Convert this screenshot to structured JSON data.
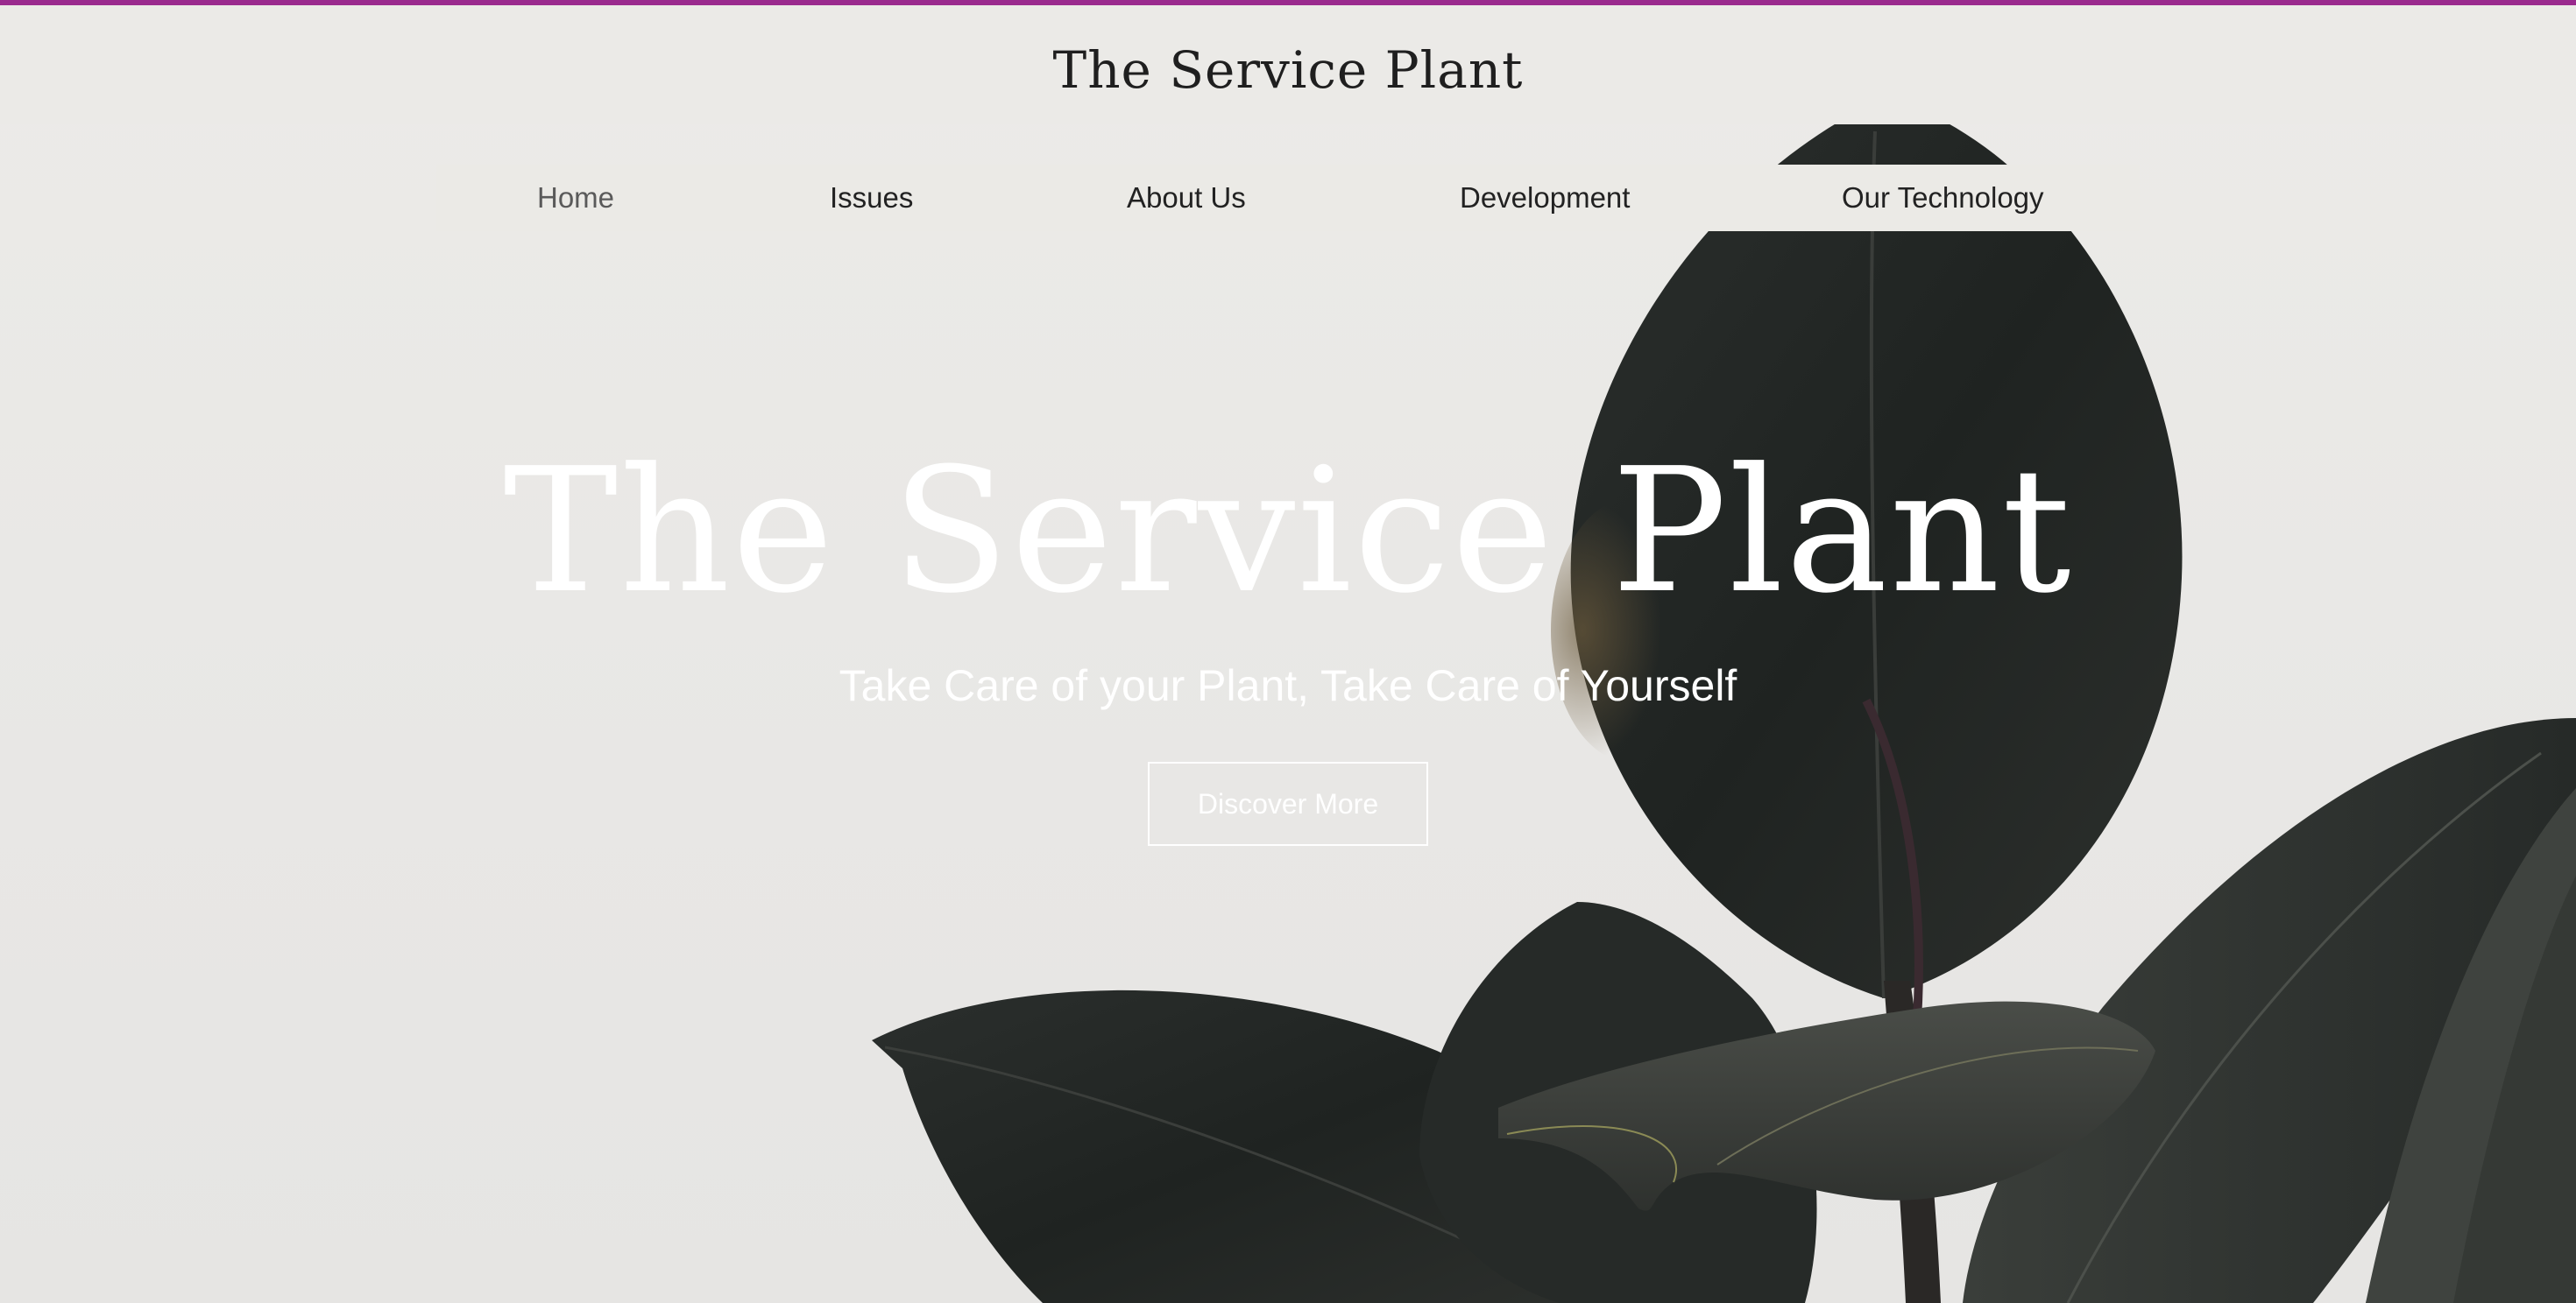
{
  "colors": {
    "accent_bar": "#9a2a8e",
    "background": "#e9e8e6",
    "leaf_dark": "#232726",
    "hero_text": "#ffffff"
  },
  "header": {
    "site_title": "The Service Plant"
  },
  "nav": {
    "items": [
      {
        "label": "Home",
        "active": true
      },
      {
        "label": "Issues",
        "active": false
      },
      {
        "label": "About Us",
        "active": false
      },
      {
        "label": "Development",
        "active": false
      },
      {
        "label": "Our Technology",
        "active": false
      }
    ]
  },
  "hero": {
    "title": "The Service Plant",
    "subtitle": "Take Care of your Plant, Take Care of Yourself",
    "cta_label": "Discover More",
    "image": "rubber-plant-leaves"
  }
}
